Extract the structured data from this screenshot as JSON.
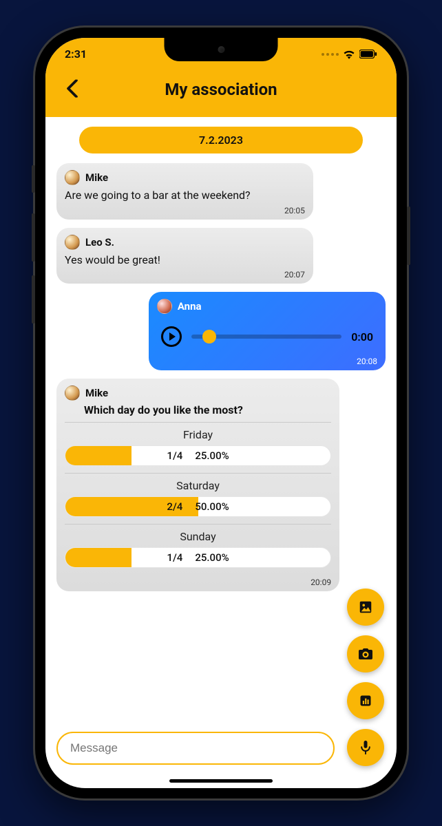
{
  "statusbar": {
    "time": "2:31"
  },
  "header": {
    "title": "My association"
  },
  "date_chip": "7.2.2023",
  "messages": [
    {
      "name": "Mike",
      "text": "Are we going to a bar at the weekend?",
      "time": "20:05"
    },
    {
      "name": "Leo S.",
      "text": "Yes would be great!",
      "time": "20:07"
    }
  ],
  "voice": {
    "name": "Anna",
    "duration": "0:00",
    "time": "20:08"
  },
  "poll": {
    "name": "Mike",
    "question": "Which day do you like the most?",
    "time": "20:09",
    "options": [
      {
        "label": "Friday",
        "count": "1/4",
        "pct": "25.00%",
        "fill": 25
      },
      {
        "label": "Saturday",
        "count": "2/4",
        "pct": "50.00%",
        "fill": 50
      },
      {
        "label": "Sunday",
        "count": "1/4",
        "pct": "25.00%",
        "fill": 25
      }
    ]
  },
  "composer": {
    "placeholder": "Message"
  }
}
